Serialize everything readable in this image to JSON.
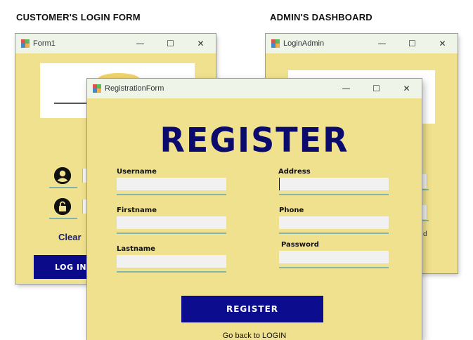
{
  "captions": {
    "customer": "CUSTOMER'S LOGIN FORM",
    "admin": "ADMIN'S DASHBOARD"
  },
  "windows": {
    "customer": {
      "title": "Form1"
    },
    "admin": {
      "title": "LoginAdmin"
    },
    "registration": {
      "title": "RegistrationForm"
    }
  },
  "window_controls": {
    "minimize": "—",
    "maximize": "☐",
    "close": "✕"
  },
  "customer_form": {
    "clear_label": "Clear",
    "login_button": "LOG IN"
  },
  "admin_form": {
    "partial_text": "d"
  },
  "registration_form": {
    "heading": "REGISTER",
    "fields": {
      "username": {
        "label": "Username",
        "value": ""
      },
      "firstname": {
        "label": "Firstname",
        "value": ""
      },
      "lastname": {
        "label": "Lastname",
        "value": ""
      },
      "address": {
        "label": "Address",
        "value": ""
      },
      "phone": {
        "label": "Phone",
        "value": ""
      },
      "password": {
        "label": "Password",
        "value": ""
      }
    },
    "register_button": "REGISTER",
    "back_link": "Go back to LOGIN"
  },
  "colors": {
    "form_background": "#efe18d",
    "accent_navy": "#0b0b8a",
    "underline_teal": "#84b6b0",
    "titlebar": "#eef4e8"
  },
  "icons": [
    "app-icon",
    "user-icon",
    "lock-icon",
    "minimize-icon",
    "maximize-icon",
    "close-icon"
  ]
}
